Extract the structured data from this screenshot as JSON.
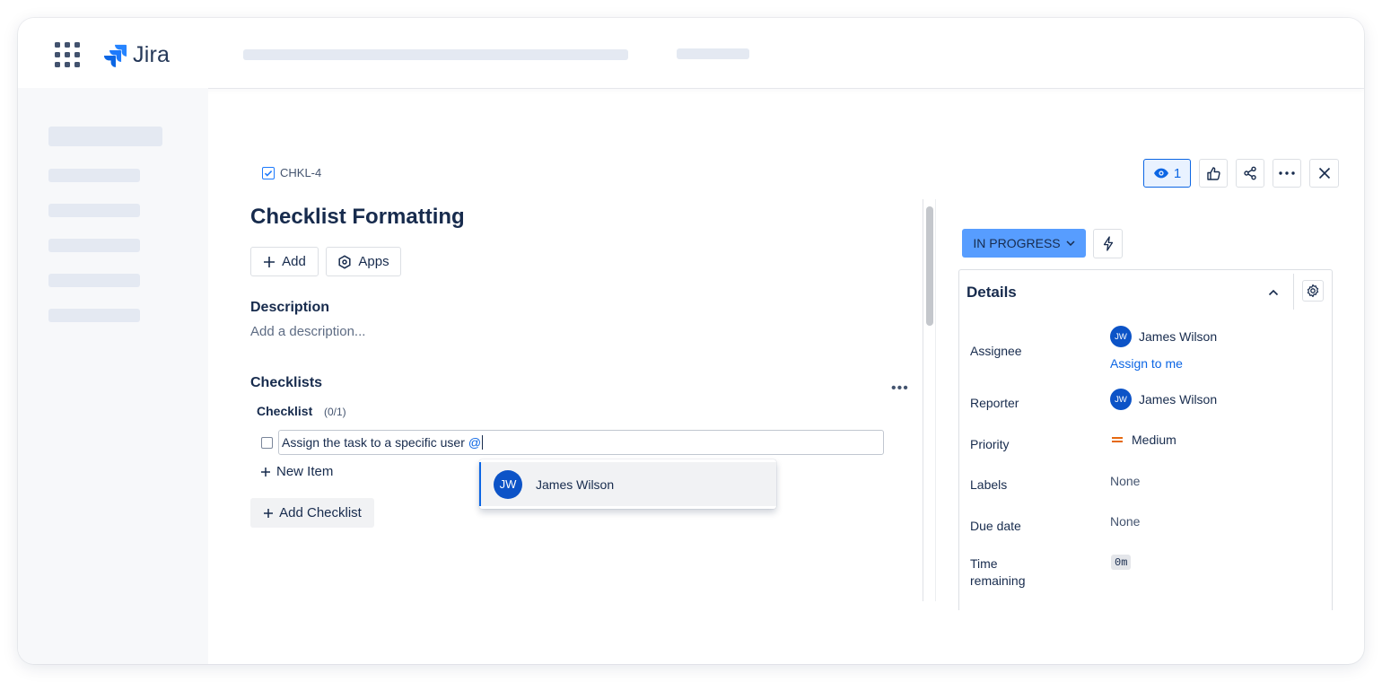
{
  "app": {
    "name": "Jira"
  },
  "issue": {
    "key": "CHKL-4",
    "title": "Checklist Formatting",
    "add_label": "Add",
    "apps_label": "Apps"
  },
  "description": {
    "heading": "Description",
    "placeholder": "Add a description..."
  },
  "checklists": {
    "heading": "Checklists",
    "list_name": "Checklist",
    "progress": "(0/1)",
    "item_text": "Assign the task to a specific user",
    "item_mention": "@",
    "new_item_label": "New Item",
    "add_checklist_label": "Add Checklist"
  },
  "mention_popup": {
    "initials": "JW",
    "name": "James Wilson"
  },
  "toolbar": {
    "watch_count": "1"
  },
  "status": {
    "label": "IN PROGRESS",
    "color": "#579dff"
  },
  "details": {
    "title": "Details",
    "assignee": {
      "label": "Assignee",
      "initials": "JW",
      "name": "James Wilson",
      "assign_to_me": "Assign to me"
    },
    "reporter": {
      "label": "Reporter",
      "initials": "JW",
      "name": "James Wilson"
    },
    "priority": {
      "label": "Priority",
      "value": "Medium",
      "color": "#e56910"
    },
    "labels": {
      "label": "Labels",
      "value": "None"
    },
    "due_date": {
      "label": "Due date",
      "value": "None"
    },
    "time_remaining": {
      "label_line1": "Time",
      "label_line2": "remaining",
      "value": "0m"
    }
  },
  "colors": {
    "accent": "#0c66e4",
    "avatar": "#0c53c7",
    "skeleton": "#e4e9f2"
  }
}
